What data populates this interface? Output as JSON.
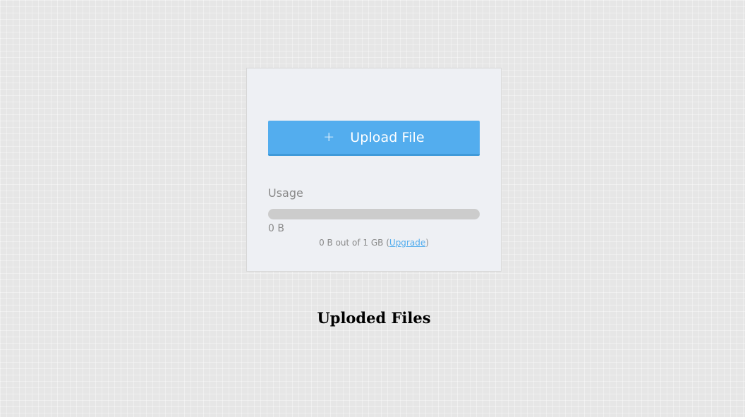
{
  "upload": {
    "icon": "plus-icon",
    "plus_glyph": "+",
    "label": "Upload File",
    "color": "#53adee"
  },
  "usage": {
    "title": "Usage",
    "used": "0 B",
    "fraction_used": 0,
    "summary_prefix": "0 B out of 1 GB (",
    "upgrade_label": "Upgrade",
    "summary_suffix": ")"
  },
  "files": {
    "heading": "Uploded Files"
  }
}
